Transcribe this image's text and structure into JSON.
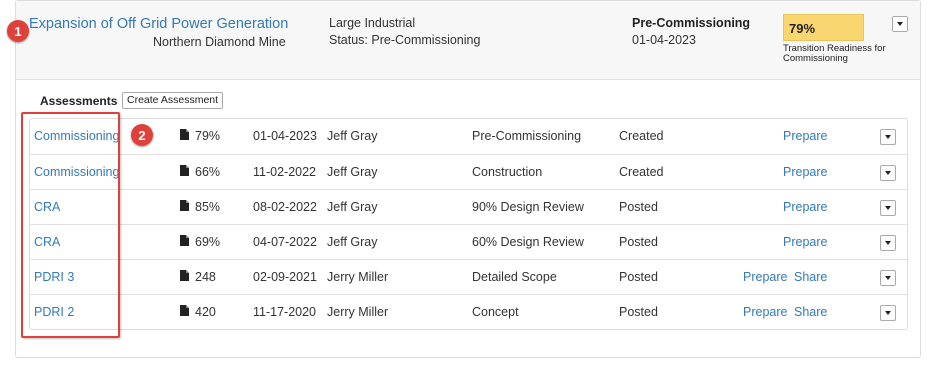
{
  "project": {
    "title": "Expansion of Off Grid Power Generation",
    "subtitle": "Northern Diamond Mine",
    "type": "Large Industrial",
    "status": "Status: Pre-Commissioning",
    "phase": "Pre-Commissioning",
    "date": "01-04-2023",
    "readiness_pct": "79%",
    "readiness_label": "Transition Readiness for Commissioning",
    "readiness_color": "#f9d66f"
  },
  "assessments": {
    "title": "Assessments",
    "create_label": "Create Assessment",
    "rows": [
      {
        "name": "Commissioning",
        "icon": "document-icon",
        "score": "79%",
        "date": "01-04-2023",
        "user": "Jeff Gray",
        "phase": "Pre-Commissioning",
        "status": "Created",
        "prepare": "Prepare",
        "share": ""
      },
      {
        "name": "Commissioning",
        "icon": "document-icon",
        "score": "66%",
        "date": "11-02-2022",
        "user": "Jeff Gray",
        "phase": "Construction",
        "status": "Created",
        "prepare": "Prepare",
        "share": ""
      },
      {
        "name": "CRA",
        "icon": "document-icon",
        "score": "85%",
        "date": "08-02-2022",
        "user": "Jeff Gray",
        "phase": "90% Design Review",
        "status": "Posted",
        "prepare": "Prepare",
        "share": ""
      },
      {
        "name": "CRA",
        "icon": "document-icon",
        "score": "69%",
        "date": "04-07-2022",
        "user": "Jeff Gray",
        "phase": "60% Design Review",
        "status": "Posted",
        "prepare": "Prepare",
        "share": ""
      },
      {
        "name": "PDRI 3",
        "icon": "document-icon",
        "score": "248",
        "date": "02-09-2021",
        "user": "Jerry Miller",
        "phase": "Detailed Scope",
        "status": "Posted",
        "prepare": "Prepare",
        "share": "Share"
      },
      {
        "name": "PDRI 2",
        "icon": "document-icon",
        "score": "420",
        "date": "11-17-2020",
        "user": "Jerry Miller",
        "phase": "Concept",
        "status": "Posted",
        "prepare": "Prepare",
        "share": "Share"
      }
    ]
  },
  "annotations": {
    "marker_1": "1",
    "marker_2": "2",
    "color": "#e0403a"
  }
}
